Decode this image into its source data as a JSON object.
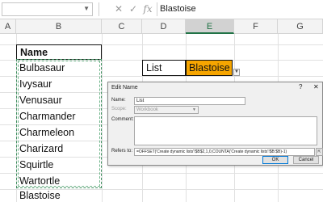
{
  "formula_bar": {
    "cancel_icon": "✕",
    "enter_icon": "✓",
    "fx_label": "fx",
    "value": "Blastoise"
  },
  "columns": [
    "A",
    "B",
    "C",
    "D",
    "E",
    "F",
    "G"
  ],
  "selected_column": "E",
  "sheet": {
    "name_header": "Name",
    "names": [
      "Bulbasaur",
      "Ivysaur",
      "Venusaur",
      "Charmander",
      "Charmeleon",
      "Charizard",
      "Squirtle",
      "Wartortle",
      "Blastoise"
    ],
    "list_label": "List",
    "list_value": "Blastoise",
    "highlight_color": "#f6a500"
  },
  "dialog": {
    "title": "Edit Name",
    "help": "?",
    "close": "✕",
    "name_label": "Name:",
    "name_value": "List",
    "scope_label": "Scope:",
    "scope_value": "Workbook",
    "comment_label": "Comment:",
    "refers_label": "Refers to:",
    "refers_value": "=OFFSET('Create dynamic lists'!$B$2,1,0,COUNTA('Create dynamic lists'!$B:$B)-1)",
    "ok_label": "OK",
    "cancel_label": "Cancel"
  }
}
